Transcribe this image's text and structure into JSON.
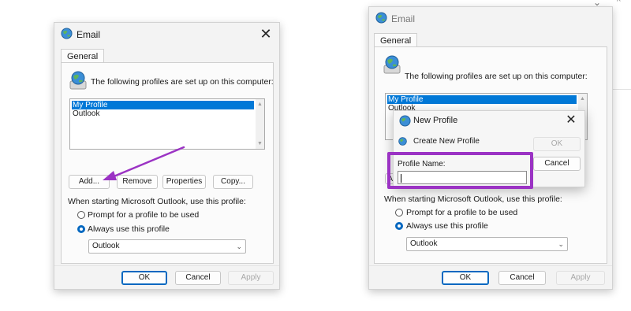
{
  "left_dialog": {
    "title": "Email",
    "tab": "General",
    "heading": "The following profiles are set up on this computer:",
    "profiles": [
      "My Profile",
      "Outlook"
    ],
    "selected_profile": "My Profile",
    "buttons": {
      "add": "Add...",
      "remove": "Remove",
      "properties": "Properties",
      "copy": "Copy..."
    },
    "startup_label": "When starting Microsoft Outlook, use this profile:",
    "radio_prompt": "Prompt for a profile to be used",
    "radio_always": "Always use this profile",
    "selected_radio": "Always use this profile",
    "profile_dropdown_value": "Outlook",
    "footer": {
      "ok": "OK",
      "cancel": "Cancel",
      "apply": "Apply"
    }
  },
  "right_dialog": {
    "title": "Email",
    "tab": "General",
    "heading": "The following profiles are set up on this computer:",
    "profiles": [
      "My Profile",
      "Outlook"
    ],
    "selected_profile": "My Profile",
    "partial_button_text": "A",
    "startup_label": "When starting Microsoft Outlook, use this profile:",
    "radio_prompt": "Prompt for a profile to be used",
    "radio_always": "Always use this profile",
    "selected_radio": "Always use this profile",
    "profile_dropdown_value": "Outlook",
    "footer": {
      "ok": "OK",
      "cancel": "Cancel",
      "apply": "Apply"
    }
  },
  "new_profile_dialog": {
    "title": "New Profile",
    "subtitle": "Create New Profile",
    "ok": "OK",
    "cancel": "Cancel",
    "field_label": "Profile Name:",
    "field_value": ""
  },
  "annotations": {
    "arrow_color": "#9b33c4",
    "highlight_color": "#9b33c4"
  },
  "icons": [
    "globe-icon",
    "close-icon",
    "chevron-down-icon",
    "scroll-up-icon",
    "scroll-down-icon",
    "arrow-annotation"
  ]
}
